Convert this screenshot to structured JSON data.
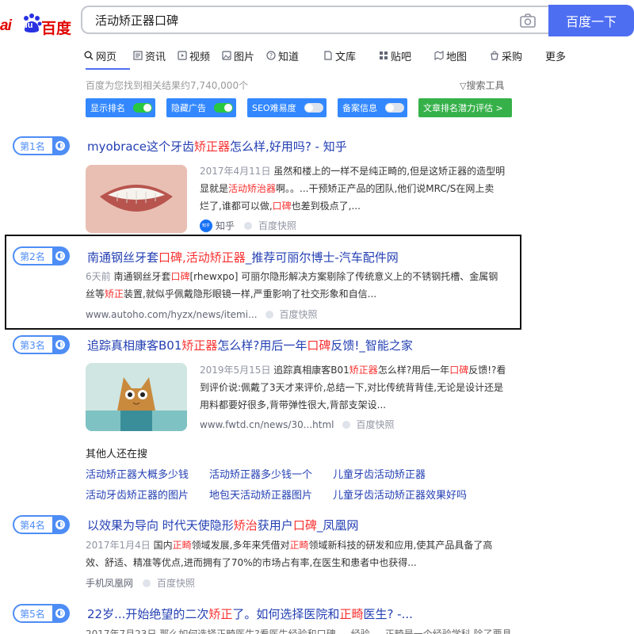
{
  "header": {
    "logo_left": "ai",
    "logo_mid": "du",
    "logo_right": "百度",
    "query": "活动矫正器口碑",
    "search_button": "百度一下"
  },
  "tabs": [
    "网页",
    "资讯",
    "视频",
    "图片",
    "知道",
    "文库",
    "贴吧",
    "地图",
    "采购",
    "更多"
  ],
  "result_count": "百度为您找到相关结果约7,740,000个",
  "search_tools": "搜索工具",
  "toggles": [
    {
      "label": "显示排名",
      "on": true
    },
    {
      "label": "隐藏广告",
      "on": true
    },
    {
      "label": "SEO难易度",
      "on": false
    },
    {
      "label": "备案信息",
      "on": false
    }
  ],
  "article_button": "文章排名潜力评估 >",
  "results": [
    {
      "rank": "第1名",
      "title": [
        "myobrace这个牙齿",
        "矫正器",
        "怎么样,好用吗? - 知乎"
      ],
      "snippet_date": "2017年4月11日",
      "snippet_lines": [
        [
          "虽然和楼上的一样不是纯正畸的,但是这矫正器的造型明"
        ],
        [
          "显就是",
          "活动矫治器",
          "啊。。...干预矫正产品的团队,他们说MRC/S在网上卖"
        ],
        [
          "烂了,谁都可以做,",
          "口碑",
          "也差到极点了,..."
        ]
      ],
      "source": "知乎",
      "source_badge": "知乎",
      "kuaizhao": "百度快照"
    },
    {
      "rank": "第2名",
      "title": [
        "南通钢丝牙套",
        "口碑",
        "",
        ",活动矫正器",
        "_推荐可丽尔博士-汽车配件网"
      ],
      "snippet_date": "6天前",
      "snippet_lines": [
        [
          "南通钢丝牙套",
          "口碑",
          "[rhewxpo] 可丽尔隐形解决方案剔除了传统意义上的不锈钢托槽、金属钢"
        ],
        [
          "丝等",
          "矫正",
          "装置,就似乎佩戴隐形眼镜一样,严重影响了社交形象和自信..."
        ]
      ],
      "url": "www.autoho.com/hyzx/news/itemi...",
      "kuaizhao": "百度快照"
    },
    {
      "rank": "第3名",
      "title": [
        "追踪真相康客B01",
        "矫正器",
        "怎么样?用后一年",
        "口碑",
        "反馈!_智能之家"
      ],
      "snippet_date": "2019年5月15日",
      "snippet_lines": [
        [
          "追踪真相康客B01",
          "矫正器",
          "怎么样?用后一年",
          "口碑",
          "反馈!?看"
        ],
        [
          "到评价说:佩戴了3天才来评价,总结一下,对比传统背背佳,无论是设计还是"
        ],
        [
          "用料都要好很多,背带弹性很大,背部支架设..."
        ]
      ],
      "url": "www.fwtd.cn/news/30...html",
      "kuaizhao": "百度快照"
    },
    {
      "rank": "第4名",
      "title": [
        "以效果为导向 时代天使隐形",
        "矫治",
        "获用户",
        "口碑",
        "_凤凰网"
      ],
      "snippet_date": "2017年1月4日",
      "snippet_lines": [
        [
          "国内",
          "正畸",
          "领域发展,多年来凭借对",
          "正畸",
          "领域新科技的研发和应用,使其产品具备了高"
        ],
        [
          "效、舒适、精准等优点,进而拥有了70%的市场占有率,在医生和患者中也获得..."
        ]
      ],
      "source": "手机凤凰网",
      "kuaizhao": "百度快照"
    },
    {
      "rank": "第5名",
      "title": [
        "22岁...开始绝望的二次",
        "矫正",
        "了。如何选择医院和",
        "正畸",
        "医生? -..."
      ],
      "snippet_lines": [
        [
          "2017年7月23日 那么如何选择正畸医生?看医生经验和口碑 ... 经验 ... 正畸是一个经验学科,除了要具"
        ]
      ]
    }
  ],
  "also_search": {
    "label": "其他人还在搜",
    "links": [
      "活动矫正器大概多少钱",
      "活动矫正器多少钱一个",
      "儿童牙齿活动矫正器",
      "活动牙齿矫正器的图片",
      "地包天活动矫正器图片",
      "儿童牙齿活动矫正器效果好吗"
    ]
  },
  "colors": {
    "accent": "#4e6ef2",
    "link": "#2440b3",
    "highlight": "#f73131",
    "badge": "#4e8df5"
  }
}
